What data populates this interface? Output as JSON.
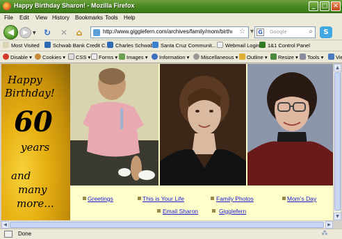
{
  "window": {
    "title": "Happy Birthday Sharon! - Mozilla Firefox"
  },
  "menu": [
    "File",
    "Edit",
    "View",
    "History",
    "Bookmarks",
    "Tools",
    "Help"
  ],
  "navigation": {
    "url": "http://www.gigglefern.com/archives/family/mom/birthday.",
    "search_placeholder": "Google"
  },
  "bookmarks": [
    "Most Visited",
    "Schwab Bank Credit C...",
    "Charles Schwab",
    "Santa Cruz Communit...",
    "Webmail Login",
    "1&1 Control Panel"
  ],
  "devtoolbar": [
    "Disable",
    "Cookies",
    "CSS",
    "Forms",
    "Images",
    "Information",
    "Miscellaneous",
    "Outline",
    "Resize",
    "Tools",
    "Vie"
  ],
  "page": {
    "banner_lines": [
      "Happy",
      "Birthday!",
      "60",
      "years",
      "and",
      "many",
      "more..."
    ],
    "links_row1": [
      "Greetings",
      "This is Your Life",
      "Family Photos",
      "Mom's Day"
    ],
    "links_row2": [
      "Email Sharon",
      "Gigglefern"
    ]
  },
  "status": {
    "text": "Done"
  },
  "colors": {
    "title_bar": "#4d8a25",
    "page_bg": "#ffffcc",
    "link": "#1a1ad0"
  }
}
